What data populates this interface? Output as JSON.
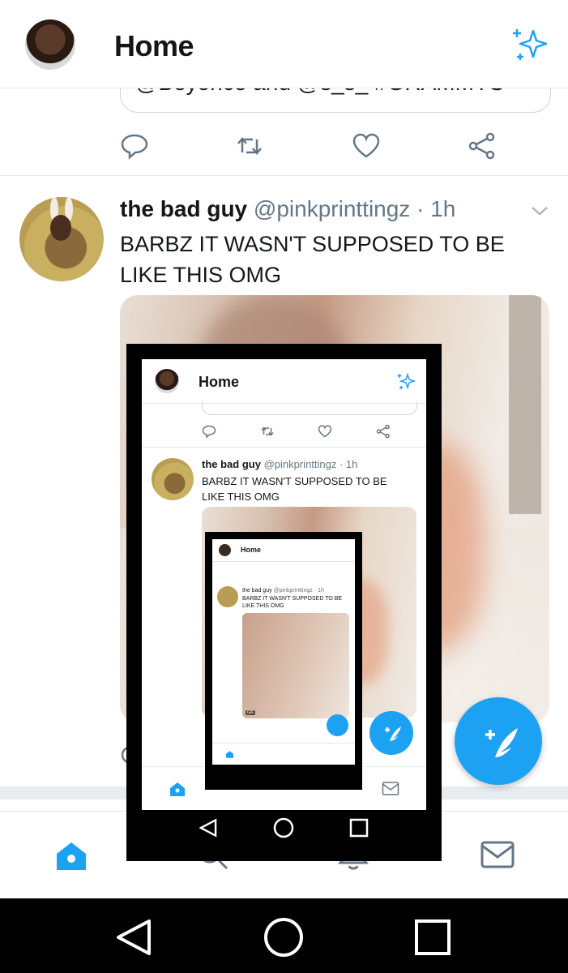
{
  "header": {
    "title": "Home",
    "sparkle_icon": "sparkle-icon"
  },
  "previous_tweet": {
    "quote_text": "@Beyonce and @s_s_ #GRAMMYS"
  },
  "tweet": {
    "name": "the bad guy",
    "handle": "@pinkprinttingz",
    "dot": "·",
    "time": "1h",
    "text": "BARBZ IT WASN'T SUPPOSED TO BE LIKE THIS OMG"
  },
  "nested": {
    "title": "Home",
    "name": "the bad guy",
    "handle_time": "@pinkprinttingz · 1h",
    "text": "BARBZ IT WASN'T SUPPOSED TO BE LIKE THIS OMG",
    "gif_badge": "GIF"
  },
  "nav": {
    "items": [
      "home-icon",
      "search-icon",
      "notifications-icon",
      "messages-icon"
    ]
  },
  "system_nav": [
    "back-icon",
    "home-circle-icon",
    "recents-icon"
  ],
  "colors": {
    "accent": "#1da1f2",
    "muted": "#657786",
    "border": "#e1e8ed"
  }
}
